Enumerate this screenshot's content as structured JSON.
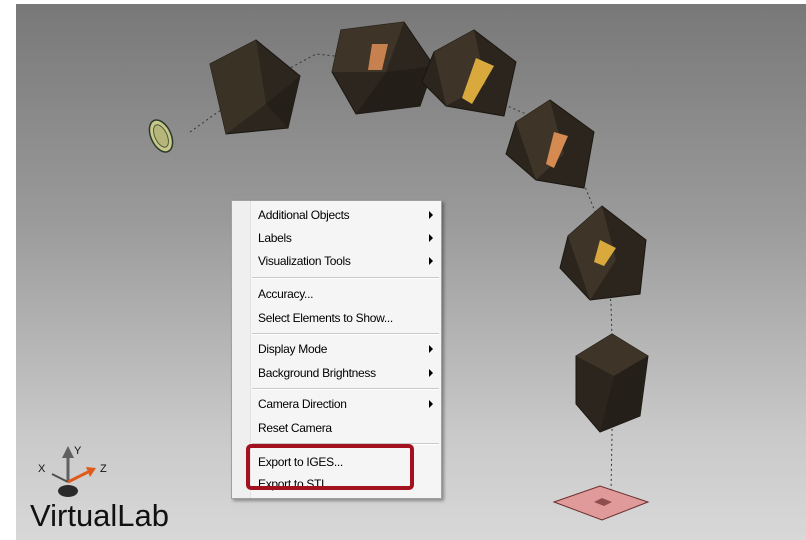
{
  "app": {
    "brand": "VirtualLab"
  },
  "axes": {
    "x_label": "X",
    "y_label": "Y",
    "z_label": "Z"
  },
  "context_menu": {
    "items": [
      {
        "label": "Additional Objects",
        "submenu": true
      },
      {
        "label": "Labels",
        "submenu": true
      },
      {
        "label": "Visualization Tools",
        "submenu": true
      },
      {
        "label": "Accuracy...",
        "submenu": false
      },
      {
        "label": "Select Elements to Show...",
        "submenu": false
      },
      {
        "label": "Display Mode",
        "submenu": true
      },
      {
        "label": "Background Brightness",
        "submenu": true
      },
      {
        "label": "Camera Direction",
        "submenu": true
      },
      {
        "label": "Reset Camera",
        "submenu": false
      },
      {
        "label": "Export to IGES...",
        "submenu": false
      },
      {
        "label": "Export to STL...",
        "submenu": false
      }
    ]
  },
  "colors": {
    "highlight_border": "#a4111e",
    "prism_dark": "#2a241c",
    "prism_face": "#3f3528",
    "prism_accent_orange": "#d58a52",
    "prism_accent_yellow": "#d9a93d",
    "source": "#c9c88a",
    "detector": "#e09a9a"
  }
}
